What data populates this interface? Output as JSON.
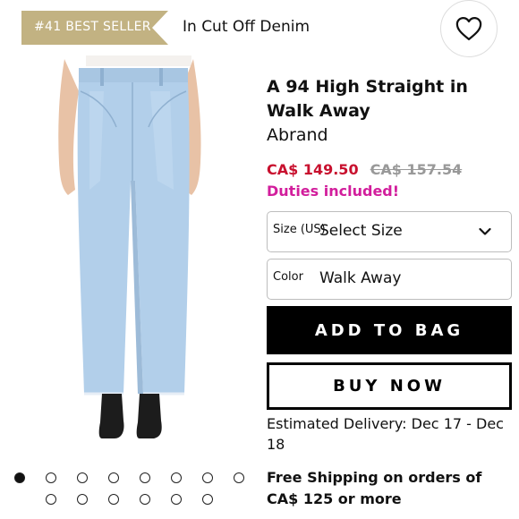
{
  "badge": {
    "text": "#41 BEST SELLER",
    "color": "#c2b282"
  },
  "collection_label": "In Cut Off Denim",
  "wishlist": {
    "icon": "heart-icon"
  },
  "product": {
    "title": "A 94 High Straight in Walk Away",
    "brand": "Abrand",
    "price": "CA$ 149.50",
    "original_price": "CA$ 157.54",
    "duties": "Duties included!",
    "image": "light-wash-straight-jeans"
  },
  "size": {
    "label": "Size (US)",
    "value": "Select Size",
    "icon": "chevron-down-icon"
  },
  "color": {
    "label": "Color",
    "value": "Walk Away"
  },
  "buttons": {
    "add_to_bag": "ADD TO BAG",
    "buy_now": "BUY NOW"
  },
  "delivery": "Estimated Delivery: Dec 17 - Dec 18",
  "shipping": "Free Shipping on orders of CA$ 125 or more",
  "carousel": {
    "total": 14,
    "active": 1
  },
  "colors": {
    "sale": "#c8102e",
    "duties": "#d21e9c",
    "accent": "#000000"
  }
}
